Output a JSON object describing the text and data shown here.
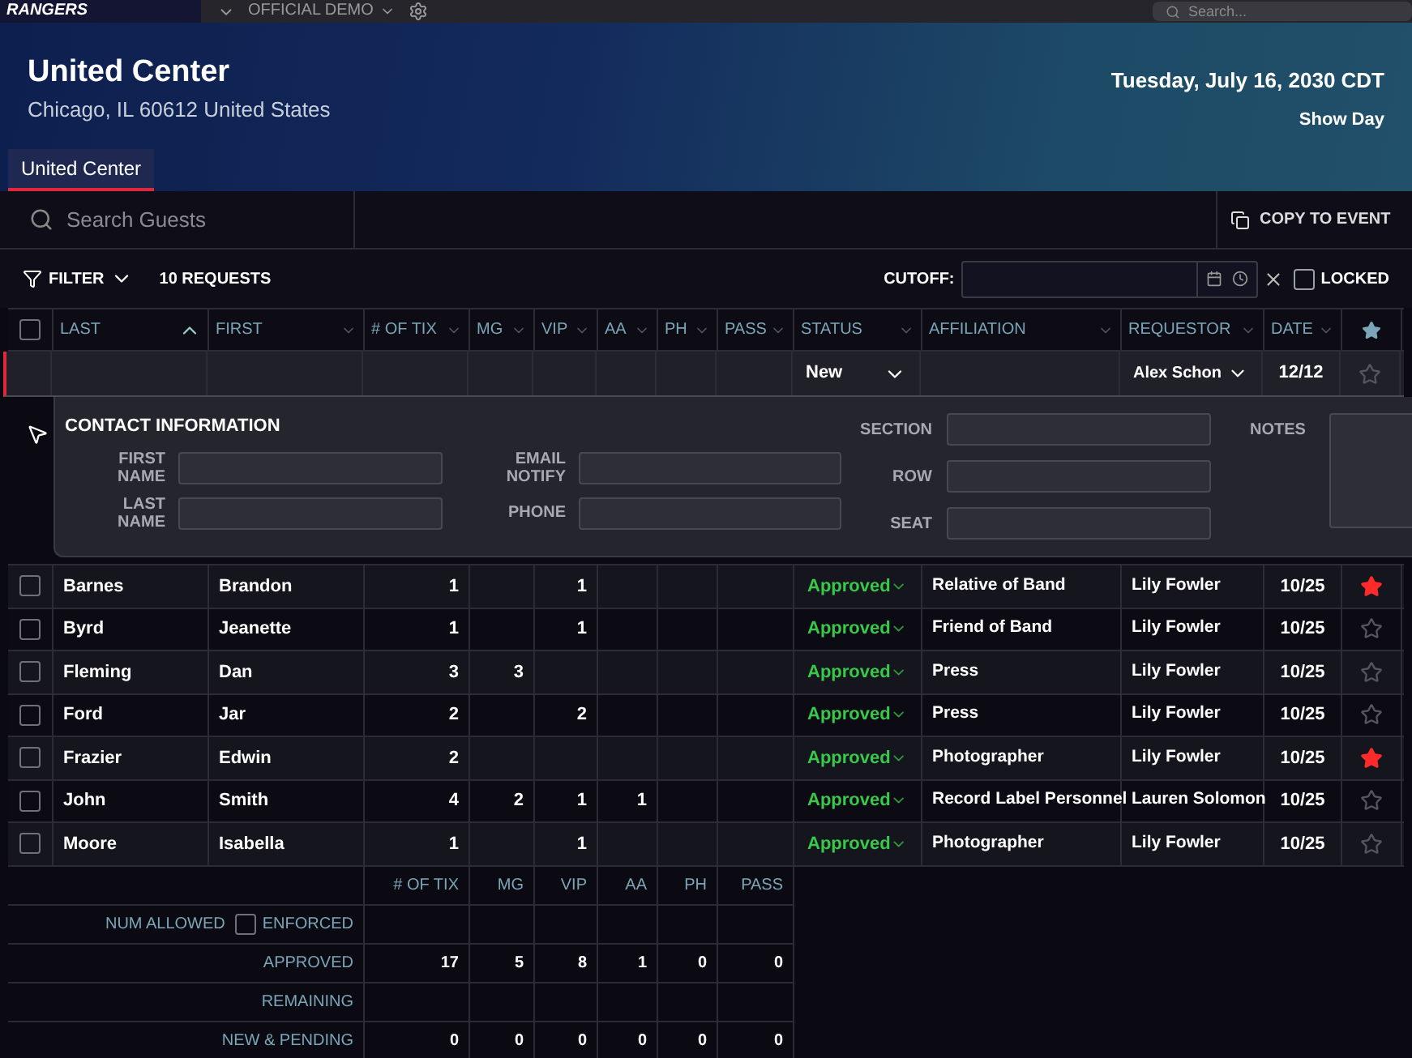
{
  "top_bar": {
    "logo": "RANGERS",
    "org": "OFFICIAL DEMO",
    "search_placeholder": "Search..."
  },
  "venue": {
    "name": "United Center",
    "address": "Chicago, IL 60612 United States",
    "date": "Tuesday, July 16, 2030 CDT",
    "day_type": "Show Day"
  },
  "tabs": [
    {
      "label": "United Center",
      "selected": true
    }
  ],
  "toolbar": {
    "search_placeholder": "Search Guests",
    "copy_button": "COPY TO EVENT",
    "filter": "FILTER",
    "request_count": "10 REQUESTS",
    "cutoff_label": "CUTOFF:",
    "locked": {
      "label": "LOCKED",
      "checked": false
    }
  },
  "table": {
    "select_all_checked": false,
    "columns": [
      {
        "label": "LAST",
        "sorted": true
      },
      {
        "label": "FIRST",
        "sorted": false
      },
      {
        "label": "# OF TIX",
        "sorted": false
      },
      {
        "label": "MG",
        "sorted": false
      },
      {
        "label": "VIP",
        "sorted": false
      },
      {
        "label": "AA",
        "sorted": false
      },
      {
        "label": "PH",
        "sorted": false
      },
      {
        "label": "PASS",
        "sorted": false
      },
      {
        "label": "STATUS",
        "sorted": false
      },
      {
        "label": "AFFILIATION",
        "sorted": false
      },
      {
        "label": "REQUESTOR",
        "sorted": false
      },
      {
        "label": "DATE",
        "sorted": false
      }
    ],
    "new_row": {
      "status": {
        "label": "New",
        "kind": "new"
      },
      "requestor": "Alex Schon",
      "date": "12/12",
      "starred": false
    },
    "contact": {
      "title": "CONTACT INFORMATION",
      "fields": [
        {
          "label": "FIRST NAME"
        },
        {
          "label": "LAST NAME"
        },
        {
          "label": "EMAIL NOTIFY"
        },
        {
          "label": "PHONE"
        },
        {
          "label": "SECTION"
        },
        {
          "label": "ROW"
        },
        {
          "label": "SEAT"
        }
      ],
      "notes_label": "NOTES"
    },
    "rows": [
      {
        "checked": false,
        "last": "Barnes",
        "first": "Brandon",
        "tix": "1",
        "vip": "1",
        "status": {
          "label": "Approved",
          "kind": "approved"
        },
        "affiliation": "Relative of Band",
        "requestor": "Lily Fowler",
        "date": "10/25",
        "starred": true
      },
      {
        "checked": false,
        "last": "Byrd",
        "first": "Jeanette",
        "tix": "1",
        "vip": "1",
        "status": {
          "label": "Approved",
          "kind": "approved"
        },
        "affiliation": "Friend of Band",
        "requestor": "Lily Fowler",
        "date": "10/25",
        "starred": false
      },
      {
        "checked": false,
        "last": "Fleming",
        "first": "Dan",
        "tix": "3",
        "mg": "3",
        "status": {
          "label": "Approved",
          "kind": "approved"
        },
        "affiliation": "Press",
        "requestor": "Lily Fowler",
        "date": "10/25",
        "starred": false
      },
      {
        "checked": false,
        "last": "Ford",
        "first": "Jar",
        "tix": "2",
        "vip": "2",
        "status": {
          "label": "Approved",
          "kind": "approved"
        },
        "affiliation": "Press",
        "requestor": "Lily Fowler",
        "date": "10/25",
        "starred": false
      },
      {
        "checked": false,
        "last": "Frazier",
        "first": "Edwin",
        "tix": "2",
        "status": {
          "label": "Approved",
          "kind": "approved"
        },
        "affiliation": "Photographer",
        "requestor": "Lily Fowler",
        "date": "10/25",
        "starred": true
      },
      {
        "checked": false,
        "last": "John",
        "first": "Smith",
        "tix": "4",
        "mg": "2",
        "vip": "1",
        "aa": "1",
        "status": {
          "label": "Approved",
          "kind": "approved"
        },
        "affiliation": "Record Label Personnel",
        "requestor": "Lauren Solomon",
        "date": "10/25",
        "starred": false
      },
      {
        "checked": false,
        "last": "Moore",
        "first": "Isabella",
        "tix": "1",
        "vip": "1",
        "status": {
          "label": "Approved",
          "kind": "approved"
        },
        "affiliation": "Photographer",
        "requestor": "Lily Fowler",
        "date": "10/25",
        "starred": false
      }
    ]
  },
  "totals": {
    "columns": [
      "# OF TIX",
      "MG",
      "VIP",
      "AA",
      "PH",
      "PASS"
    ],
    "enforced": {
      "label": "ENFORCED",
      "checked": false
    },
    "rows": [
      {
        "label": "NUM ALLOWED",
        "kind": "allowed"
      },
      {
        "label": "APPROVED",
        "kind": "plain",
        "values": {
          "tix": "17",
          "mg": "5",
          "vip": "8",
          "aa": "1",
          "ph": "0",
          "pass": "0"
        }
      },
      {
        "label": "REMAINING",
        "kind": "plain"
      },
      {
        "label": "NEW & PENDING",
        "kind": "plain",
        "values": {
          "tix": "0",
          "mg": "0",
          "vip": "0",
          "aa": "0",
          "ph": "0",
          "pass": "0"
        }
      }
    ]
  }
}
